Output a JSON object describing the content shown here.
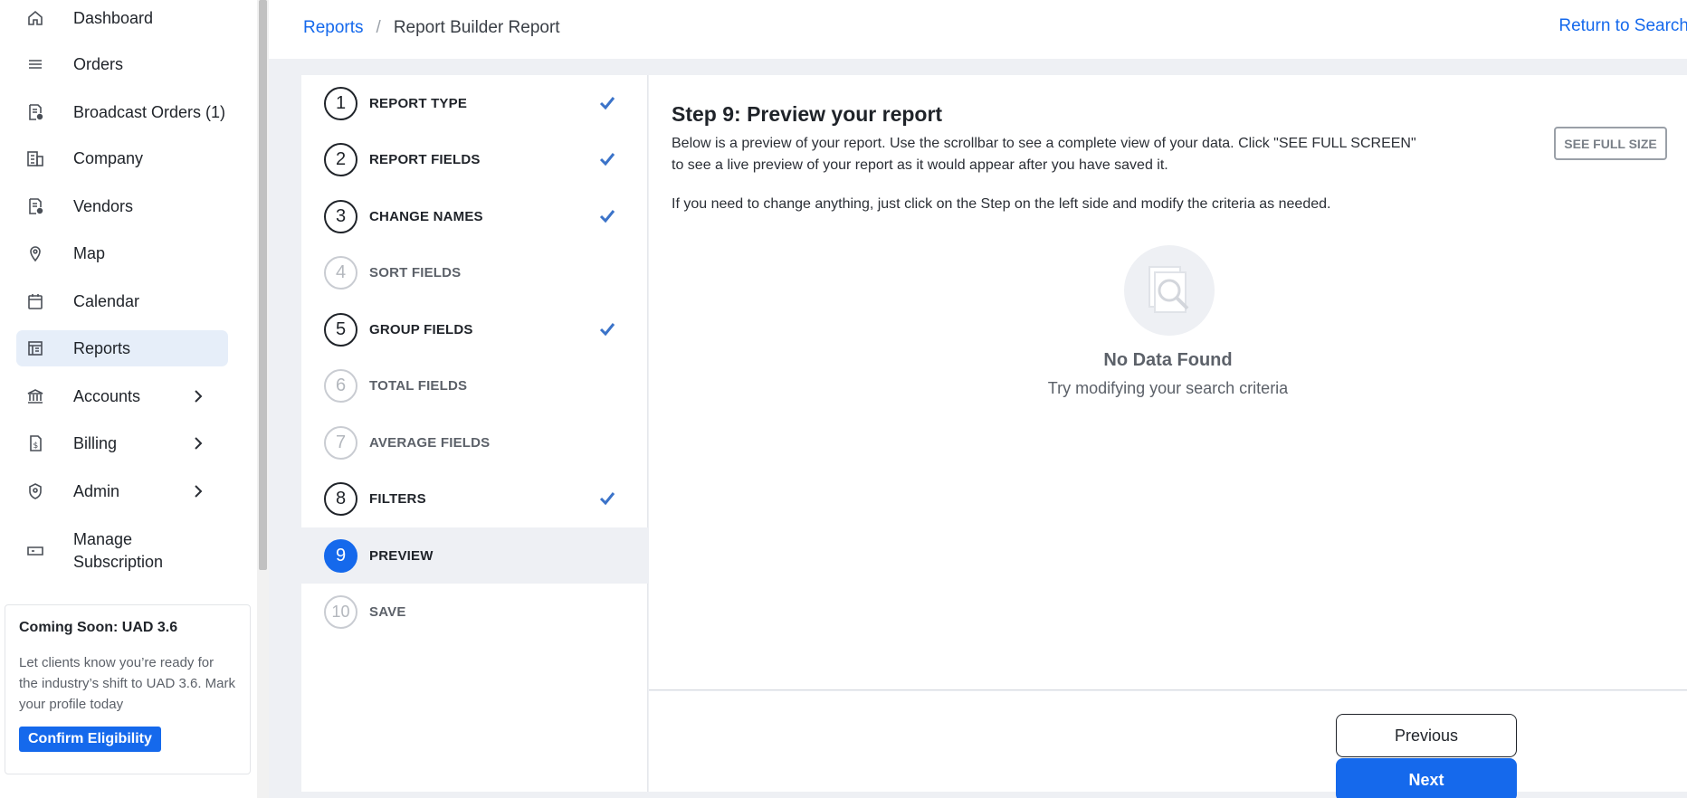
{
  "sidebar": {
    "items": [
      {
        "label": "Dashboard",
        "icon": "home-icon"
      },
      {
        "label": "Orders",
        "icon": "list-icon"
      },
      {
        "label": "Broadcast Orders (1)",
        "icon": "broadcast-document-icon"
      },
      {
        "label": "Company",
        "icon": "building-icon"
      },
      {
        "label": "Vendors",
        "icon": "vendor-document-icon"
      },
      {
        "label": "Map",
        "icon": "map-pin-icon"
      },
      {
        "label": "Calendar",
        "icon": "calendar-icon"
      },
      {
        "label": "Reports",
        "icon": "reports-icon",
        "active": true
      },
      {
        "label": "Accounts",
        "icon": "bank-icon",
        "expandable": true
      },
      {
        "label": "Billing",
        "icon": "billing-icon",
        "expandable": true
      },
      {
        "label": "Admin",
        "icon": "shield-icon",
        "expandable": true
      },
      {
        "label_line1": "Manage",
        "label_line2": "Subscription",
        "icon": "ticket-icon"
      }
    ],
    "promo": {
      "title": "Coming Soon: UAD 3.6",
      "text": "Let clients know you’re ready for the industry’s shift to UAD 3.6. Mark your profile today",
      "button": "Confirm Eligibility"
    }
  },
  "header": {
    "breadcrumb_link": "Reports",
    "breadcrumb_sep": "/",
    "breadcrumb_current": "Report Builder Report",
    "return_link": "Return to Search"
  },
  "steps": [
    {
      "num": "1",
      "label": "REPORT TYPE",
      "done": true
    },
    {
      "num": "2",
      "label": "REPORT FIELDS",
      "done": true
    },
    {
      "num": "3",
      "label": "CHANGE NAMES",
      "done": true
    },
    {
      "num": "4",
      "label": "SORT FIELDS",
      "done": false
    },
    {
      "num": "5",
      "label": "GROUP FIELDS",
      "done": true
    },
    {
      "num": "6",
      "label": "TOTAL FIELDS",
      "done": false
    },
    {
      "num": "7",
      "label": "AVERAGE FIELDS",
      "done": false
    },
    {
      "num": "8",
      "label": "FILTERS",
      "done": true
    },
    {
      "num": "9",
      "label": "PREVIEW",
      "active": true
    },
    {
      "num": "10",
      "label": "SAVE",
      "done": false
    }
  ],
  "content": {
    "title": "Step 9: Preview your report",
    "desc": "Below is a preview of your report. Use the scrollbar to see a complete view of your data. Click \"SEE FULL SCREEN\" to see a live preview of your report as it would appear after you have saved it.",
    "desc2": "If you need to change anything, just click on the Step on the left side and modify the criteria as needed.",
    "full_size_button": "SEE FULL SIZE",
    "empty_title": "No Data Found",
    "empty_sub": "Try modifying your search criteria"
  },
  "footer": {
    "previous": "Previous",
    "next": "Next"
  },
  "colors": {
    "accent": "#1569ec",
    "active_nav_bg": "#e6eef9",
    "check": "#3b73c9"
  }
}
